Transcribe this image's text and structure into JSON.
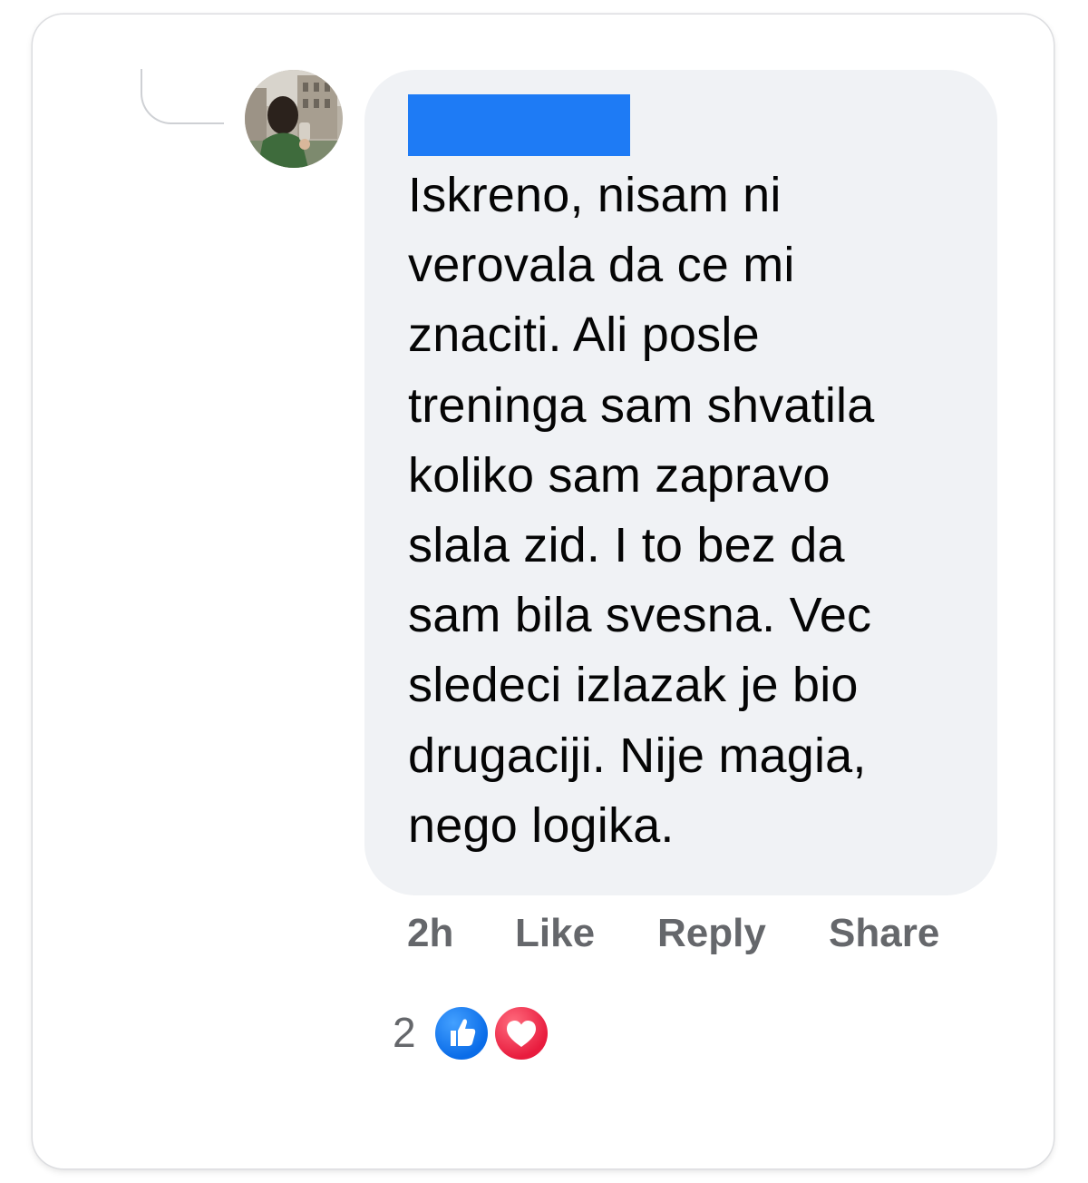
{
  "comment": {
    "text": "Iskreno, nisam ni\nverovala da ce mi\nznaciti. Ali posle\ntreninga sam shvatila\nkoliko sam zapravo\nslala zid. I to bez da\nsam bila svesna. Vec\nsledeci izlazak je bio\ndrugaciji. Nije magia,\nnego logika.",
    "redaction_color": "#1e7bf5"
  },
  "actions": {
    "time": "2h",
    "like": "Like",
    "reply": "Reply",
    "share": "Share"
  },
  "reactions": {
    "count": "2",
    "types": [
      "like-icon",
      "love-icon"
    ]
  }
}
